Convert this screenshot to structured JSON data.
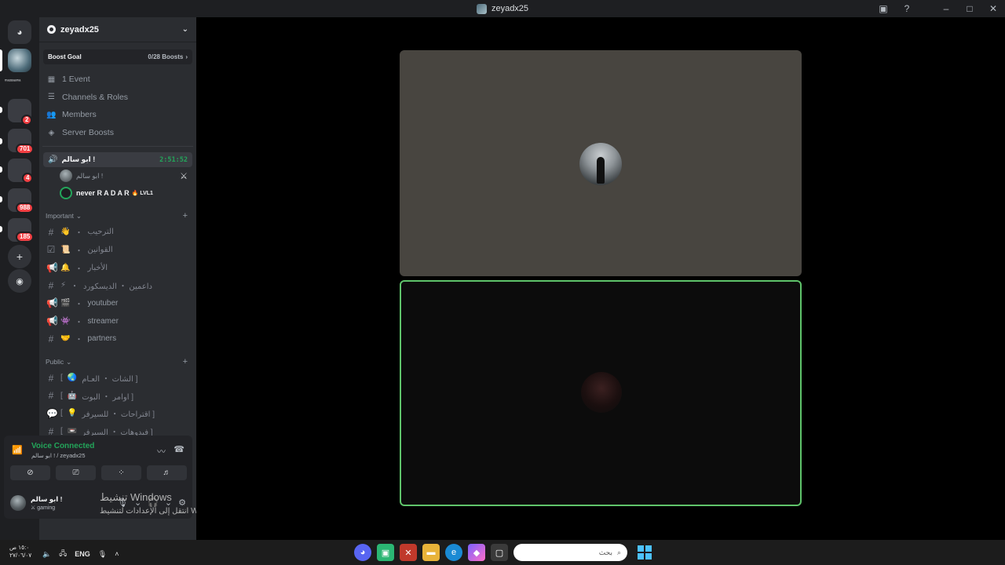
{
  "window": {
    "title": "zeyadx25"
  },
  "server": {
    "name": "zeyadx25",
    "boost_goal_label": "Boost Goal",
    "boost_count": "0/28 Boosts",
    "guild_label": "ᵐᵃᵈᵈᵃᵃᵐᵃ"
  },
  "guild_badges": [
    "2",
    "701",
    "4",
    "988",
    "185"
  ],
  "menu": [
    {
      "label": "1 Event",
      "icon": "calendar-icon"
    },
    {
      "label": "Channels & Roles",
      "icon": "channels-icon"
    },
    {
      "label": "Members",
      "icon": "members-icon"
    },
    {
      "label": "Server Boosts",
      "icon": "boost-icon"
    }
  ],
  "voice_channel": {
    "name": "ابو سالم !",
    "time": "2:51:52",
    "users": [
      {
        "name": "ابو سالم !"
      },
      {
        "name": "never R A D A R",
        "badge": "🔥 LVL1"
      }
    ]
  },
  "categories": {
    "important": {
      "label": "Important",
      "channels": [
        {
          "name": "الترحيب",
          "emoji": "👋"
        },
        {
          "name": "القوانين",
          "emoji": "📜"
        },
        {
          "name": "الأخبار",
          "emoji": "🔔"
        },
        {
          "name": "داعمين ・ الديسكورد",
          "emoji": "⚡"
        },
        {
          "name": "youtuber",
          "emoji": "🎬"
        },
        {
          "name": "streamer",
          "emoji": "👾"
        },
        {
          "name": "partners",
          "emoji": "🤝"
        }
      ]
    },
    "public": {
      "label": "Public",
      "channels": [
        {
          "name": "الشات ・ العـام ]",
          "emoji": "🌏"
        },
        {
          "name": "اوامر ・ البوت ]",
          "emoji": "🤖"
        },
        {
          "name": "اقتراحات ・ للسيرفر ]",
          "emoji": "💡"
        },
        {
          "name": "فيدوهات ・ السيرفر ]",
          "emoji": "📼"
        }
      ]
    }
  },
  "voice_panel": {
    "status": "Voice Connected",
    "sub": "ابو سالم ! / zeyadx25"
  },
  "user": {
    "name": "ابو سالم !",
    "status": "⚔ gaming"
  },
  "watermark": {
    "line1": "تنشيط Windows",
    "line2": "انتقل إلى الإعدادات لتنشيط Windows."
  },
  "taskbar": {
    "time": "١٥:٠ ص",
    "date": "٢٧/٠٦/٠٧",
    "lang": "ENG",
    "search_placeholder": "بحث"
  },
  "colors": {
    "accent_green": "#23a55a",
    "tile_border": "#5fc46b",
    "sidebar": "#2b2d31",
    "guild_bar": "#1e1f22"
  }
}
